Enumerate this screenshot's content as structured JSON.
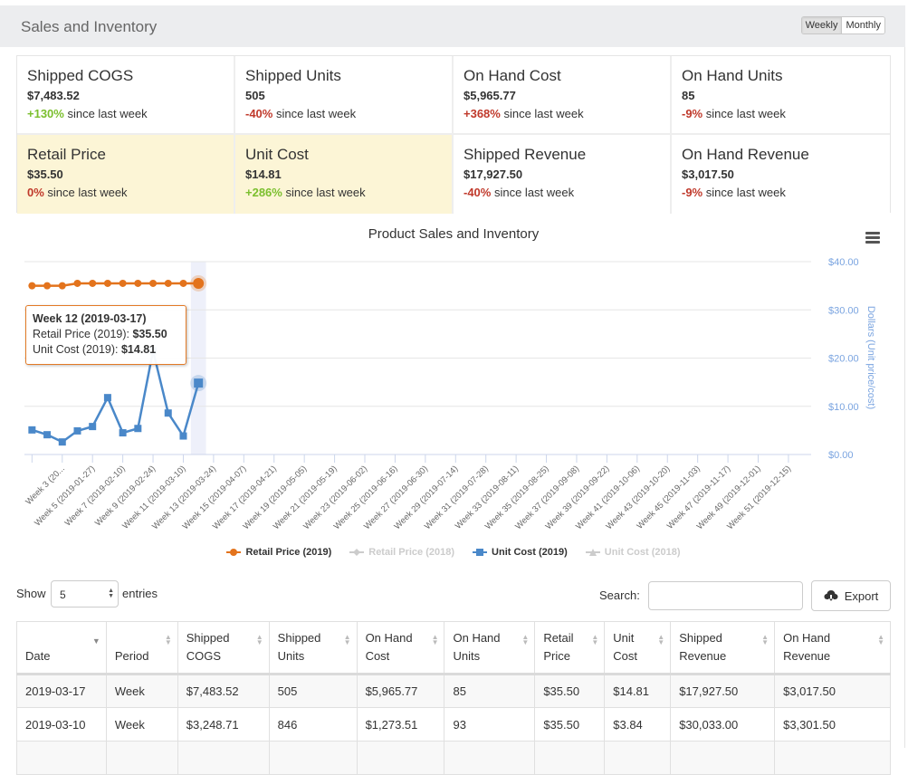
{
  "header": {
    "title": "Sales and Inventory",
    "toggle": [
      {
        "label": "Weekly",
        "active": true
      },
      {
        "label": "Monthly",
        "active": false
      }
    ]
  },
  "kpis": [
    {
      "title": "Shipped COGS",
      "value": "$7,483.52",
      "change": "+130%",
      "change_dir": "pos",
      "suffix": " since last week",
      "highlight": false
    },
    {
      "title": "Shipped Units",
      "value": "505",
      "change": "-40%",
      "change_dir": "neg",
      "suffix": " since last week",
      "highlight": false
    },
    {
      "title": "On Hand Cost",
      "value": "$5,965.77",
      "change": "+368%",
      "change_dir": "neg",
      "suffix": " since last week",
      "highlight": false
    },
    {
      "title": "On Hand Units",
      "value": "85",
      "change": "-9%",
      "change_dir": "neg",
      "suffix": " since last week",
      "highlight": false
    },
    {
      "title": "Retail Price",
      "value": "$35.50",
      "change": "0%",
      "change_dir": "neg",
      "suffix": " since last week",
      "highlight": true
    },
    {
      "title": "Unit Cost",
      "value": "$14.81",
      "change": "+286%",
      "change_dir": "pos",
      "suffix": " since last week",
      "highlight": true
    },
    {
      "title": "Shipped Revenue",
      "value": "$17,927.50",
      "change": "-40%",
      "change_dir": "neg",
      "suffix": " since last week",
      "highlight": false
    },
    {
      "title": "On Hand Revenue",
      "value": "$3,017.50",
      "change": "-9%",
      "change_dir": "neg",
      "suffix": " since last week",
      "highlight": false
    }
  ],
  "chart_menu_icon": "hamburger-menu-icon",
  "tooltip": {
    "title": "Week 12 (2019-03-17)",
    "line1_label": "Retail Price (2019): ",
    "line1_value": "$35.50",
    "line2_label": "Unit Cost (2019): ",
    "line2_value": "$14.81"
  },
  "chart_data": {
    "type": "line",
    "title": "Product Sales and Inventory",
    "xlabel": "",
    "ylabel": "Dollars (Unit price/cost)",
    "ylim": [
      0,
      40
    ],
    "yticks": [
      "$0.00",
      "$10.00",
      "$20.00",
      "$30.00",
      "$40.00"
    ],
    "ytick_values": [
      0,
      10,
      20,
      30,
      40
    ],
    "grid": true,
    "legend_position": "bottom-center",
    "x_category_count": 52,
    "xtick_labels": [
      {
        "week": 3,
        "label": "Week 3 (20..."
      },
      {
        "week": 5,
        "label": "Week 5 (2019-01-27)"
      },
      {
        "week": 7,
        "label": "Week 7 (2019-02-10)"
      },
      {
        "week": 9,
        "label": "Week 9 (2019-02-24)"
      },
      {
        "week": 11,
        "label": "Week 11 (2019-03-10)"
      },
      {
        "week": 13,
        "label": "Week 13 (2019-03-24)"
      },
      {
        "week": 15,
        "label": "Week 15 (2019-04-07)"
      },
      {
        "week": 17,
        "label": "Week 17 (2019-04-21)"
      },
      {
        "week": 19,
        "label": "Week 19 (2019-05-05)"
      },
      {
        "week": 21,
        "label": "Week 21 (2019-05-19)"
      },
      {
        "week": 23,
        "label": "Week 23 (2019-06-02)"
      },
      {
        "week": 25,
        "label": "Week 25 (2019-06-16)"
      },
      {
        "week": 27,
        "label": "Week 27 (2019-06-30)"
      },
      {
        "week": 29,
        "label": "Week 29 (2019-07-14)"
      },
      {
        "week": 31,
        "label": "Week 31 (2019-07-28)"
      },
      {
        "week": 33,
        "label": "Week 33 (2019-08-11)"
      },
      {
        "week": 35,
        "label": "Week 35 (2019-08-25)"
      },
      {
        "week": 37,
        "label": "Week 37 (2019-09-08)"
      },
      {
        "week": 39,
        "label": "Week 39 (2019-09-22)"
      },
      {
        "week": 41,
        "label": "Week 41 (2019-10-06)"
      },
      {
        "week": 43,
        "label": "Week 43 (2019-10-20)"
      },
      {
        "week": 45,
        "label": "Week 45 (2019-11-03)"
      },
      {
        "week": 47,
        "label": "Week 47 (2019-11-17)"
      },
      {
        "week": 49,
        "label": "Week 49 (2019-12-01)"
      },
      {
        "week": 51,
        "label": "Week 51 (2019-12-15)"
      }
    ],
    "highlighted_week": 12,
    "series": [
      {
        "name": "Retail Price (2019)",
        "color": "#e3731c",
        "marker": "circle",
        "visible": true,
        "weeks": [
          1,
          2,
          3,
          4,
          5,
          6,
          7,
          8,
          9,
          10,
          11,
          12
        ],
        "values": [
          35.0,
          35.0,
          35.0,
          35.5,
          35.5,
          35.5,
          35.5,
          35.5,
          35.5,
          35.5,
          35.5,
          35.5
        ]
      },
      {
        "name": "Retail Price (2018)",
        "color": "#cccccc",
        "marker": "diamond",
        "visible": false,
        "weeks": [],
        "values": []
      },
      {
        "name": "Unit Cost (2019)",
        "color": "#4a88c9",
        "marker": "square",
        "visible": true,
        "weeks": [
          1,
          2,
          3,
          4,
          5,
          6,
          7,
          8,
          9,
          10,
          11,
          12
        ],
        "values": [
          5.1,
          4.1,
          2.6,
          4.9,
          5.8,
          11.8,
          4.5,
          5.4,
          21.5,
          8.6,
          3.84,
          14.81
        ]
      },
      {
        "name": "Unit Cost (2018)",
        "color": "#cccccc",
        "marker": "triangle",
        "visible": false,
        "weeks": [],
        "values": []
      }
    ]
  },
  "table_controls": {
    "show_label": "Show",
    "length_value": "5",
    "entries_label": "entries",
    "search_label": "Search:",
    "search_value": "",
    "export_label": "Export"
  },
  "table": {
    "columns": [
      {
        "line1": "",
        "line2": "Date",
        "sort": "desc"
      },
      {
        "line1": "",
        "line2": "Period",
        "sort": "both"
      },
      {
        "line1": "Shipped",
        "line2": "COGS",
        "sort": "both"
      },
      {
        "line1": "Shipped",
        "line2": "Units",
        "sort": "both"
      },
      {
        "line1": "On Hand",
        "line2": "Cost",
        "sort": "both"
      },
      {
        "line1": "On Hand",
        "line2": "Units",
        "sort": "both"
      },
      {
        "line1": "Retail",
        "line2": "Price",
        "sort": "both"
      },
      {
        "line1": "Unit",
        "line2": "Cost",
        "sort": "both"
      },
      {
        "line1": "Shipped",
        "line2": "Revenue",
        "sort": "both"
      },
      {
        "line1": "On Hand",
        "line2": "Revenue",
        "sort": "both"
      }
    ],
    "rows": [
      [
        "2019-03-17",
        "Week",
        "$7,483.52",
        "505",
        "$5,965.77",
        "85",
        "$35.50",
        "$14.81",
        "$17,927.50",
        "$3,017.50"
      ],
      [
        "2019-03-10",
        "Week",
        "$3,248.71",
        "846",
        "$1,273.51",
        "93",
        "$35.50",
        "$3.84",
        "$30,033.00",
        "$3,301.50"
      ],
      [
        "",
        "",
        "",
        "",
        "",
        "",
        "",
        "",
        "",
        ""
      ]
    ]
  }
}
